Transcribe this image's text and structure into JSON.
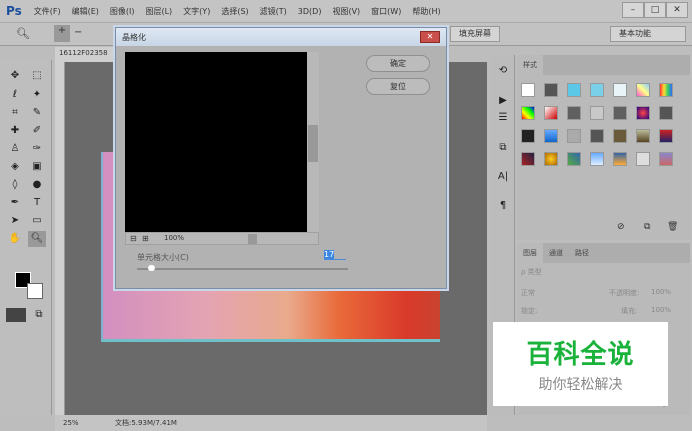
{
  "app": {
    "logo": "Ps",
    "menu": [
      "文件(F)",
      "编辑(E)",
      "图像(I)",
      "图层(L)",
      "文字(Y)",
      "选择(S)",
      "滤镜(T)",
      "3D(D)",
      "视图(V)",
      "窗口(W)",
      "帮助(H)"
    ],
    "win": [
      "–",
      "□",
      "✕"
    ]
  },
  "options": {
    "fill_screen": "填充屏幕",
    "workspace": "基本功能"
  },
  "document": {
    "tab": "16112F02358",
    "zoom": "25%",
    "info": "文档:5.93M/7.41M"
  },
  "dialog": {
    "title": "晶格化",
    "ok": "确定",
    "reset": "复位",
    "preview_zoom": "100%",
    "cell_size_label": "单元格大小(C)",
    "cell_size_value": "17",
    "cell_size_fraction": 0.05
  },
  "styles_panel": {
    "tab": "样式"
  },
  "layers_panel": {
    "tabs": [
      "图层",
      "通道",
      "路径"
    ],
    "filter": "ρ 类型",
    "blend": "正常",
    "opacity_label": "不透明度:",
    "opacity": "100%",
    "lock_label": "锁定:",
    "fill_label": "填充:",
    "fill": "100%"
  },
  "watermark": {
    "title": "百科全说",
    "subtitle": "助你轻松解决"
  },
  "colors": {
    "accent": "#19b23a",
    "close": "#c9504a"
  }
}
